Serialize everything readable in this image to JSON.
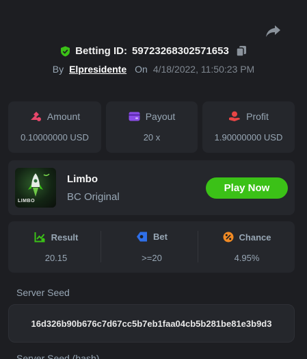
{
  "header": {
    "betting_id_label": "Betting ID:",
    "betting_id": "59723268302571653",
    "by_label": "By",
    "author": "Elpresidente",
    "on_label": "On",
    "date": "4/18/2022, 11:50:23 PM"
  },
  "stats": {
    "amount": {
      "label": "Amount",
      "value": "0.10000000 USD"
    },
    "payout": {
      "label": "Payout",
      "value": "20 x"
    },
    "profit": {
      "label": "Profit",
      "value": "1.90000000 USD"
    }
  },
  "game": {
    "name": "Limbo",
    "provider": "BC Original",
    "thumb_text": "LIMBO",
    "play_label": "Play Now"
  },
  "result": {
    "result": {
      "label": "Result",
      "value": "20.15"
    },
    "bet": {
      "label": "Bet",
      "value": ">=20"
    },
    "chance": {
      "label": "Chance",
      "value": "4.95%"
    }
  },
  "server_seed": {
    "label": "Server Seed",
    "value": "16d326b90b676c7d67cc5b7eb1faa04cb5b281be81e3b9d3"
  },
  "server_seed_hash": {
    "label": "Server Seed (hash)"
  },
  "colors": {
    "background": "#1d1e22",
    "card": "#25272c",
    "accent_green": "#3bc117",
    "muted_text": "#98a7b5"
  },
  "icons": [
    "share-icon",
    "shield-check-icon",
    "copy-icon",
    "coins-icon",
    "card-icon",
    "profit-hand-icon",
    "result-chart-icon",
    "bet-tag-icon",
    "chance-percent-icon",
    "rocket-icon"
  ]
}
